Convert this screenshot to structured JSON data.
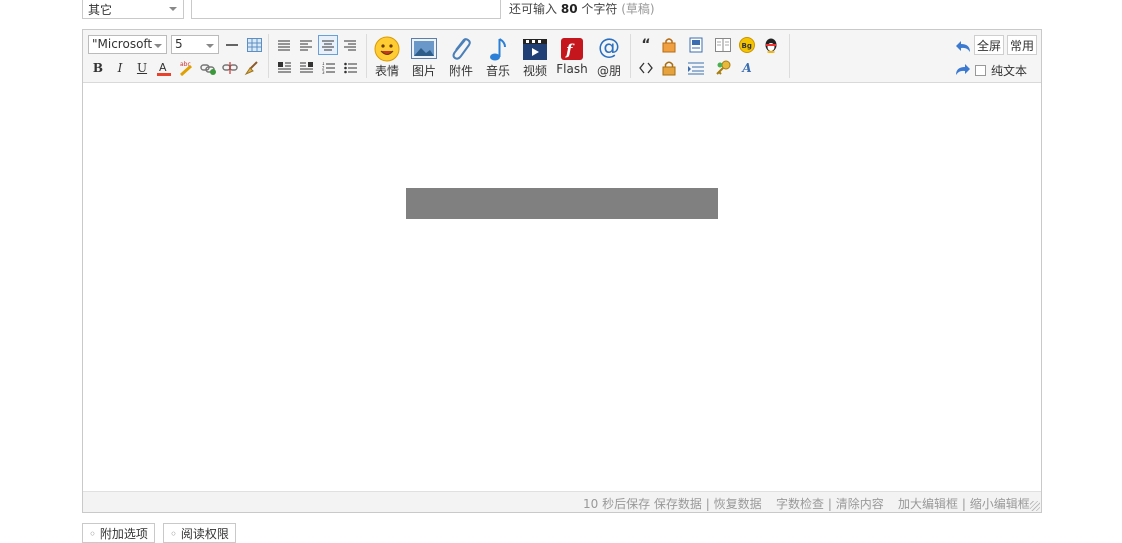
{
  "top": {
    "type_select_value": "其它",
    "title_value": "",
    "char_left_prefix": "还可输入",
    "char_left_count": "80",
    "char_left_suffix": "个字符",
    "draft_label": "(草稿)"
  },
  "toolbar": {
    "font_family": "\"Microsoft",
    "font_size": "5",
    "big_buttons": {
      "emoji": "表情",
      "image": "图片",
      "attachment": "附件",
      "music": "音乐",
      "video": "视频",
      "flash": "Flash",
      "mention": "@朋"
    },
    "fullscreen_label": "全屏",
    "common_label": "常用",
    "plain_text_label": "纯文本"
  },
  "status": {
    "autosave": "10 秒后保存",
    "save_data": "保存数据",
    "restore_data": "恢复数据",
    "word_check": "字数检查",
    "clear_content": "清除内容",
    "enlarge_editor": "加大编辑框",
    "shrink_editor": "缩小编辑框",
    "divider": "|"
  },
  "bottom_tabs": {
    "extra_options": "附加选项",
    "read_permission": "阅读权限"
  }
}
